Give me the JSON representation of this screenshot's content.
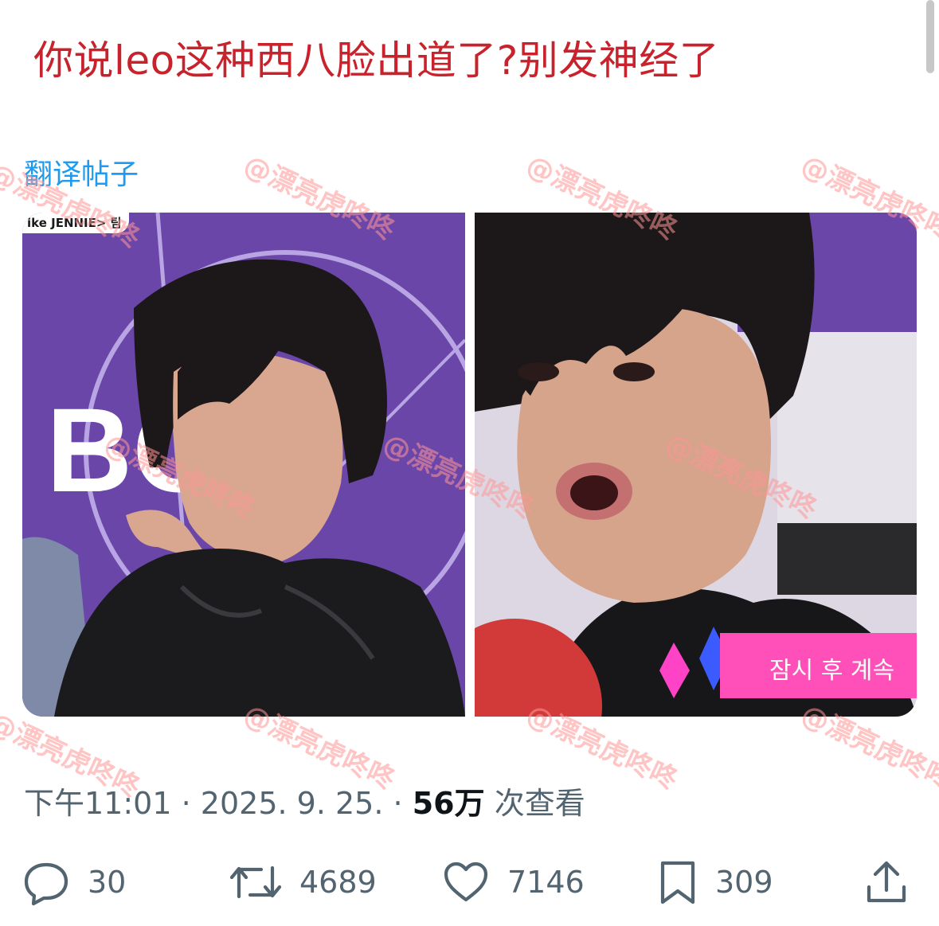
{
  "post": {
    "text": "你说leo这种西八脸出道了?别发神经了",
    "translate_label": "翻译帖子"
  },
  "media": {
    "left_photo_tag": "ike JENNIE> 팀",
    "left_backdrop_text": "BO S",
    "right_banner_text": "잠시 후 계속",
    "watermark_text": "@漂亮虎咚咚"
  },
  "meta": {
    "time": "下午11:01",
    "sep1": "·",
    "date": "2025. 9. 25.",
    "sep2": "·",
    "views_count": "56万",
    "views_label": "次查看"
  },
  "actions": {
    "replies": "30",
    "reposts": "4689",
    "likes": "7146",
    "bookmarks": "309"
  },
  "colors": {
    "post_text": "#c8232c",
    "link": "#1d9bf0",
    "meta": "#536471",
    "backdrop_purple": "#6a46a8",
    "banner_pink": "#ff4fb8",
    "watermark": "#ff9696"
  },
  "icons": {
    "reply": "reply-icon",
    "repost": "repost-icon",
    "like": "heart-icon",
    "bookmark": "bookmark-icon",
    "share": "share-icon"
  }
}
